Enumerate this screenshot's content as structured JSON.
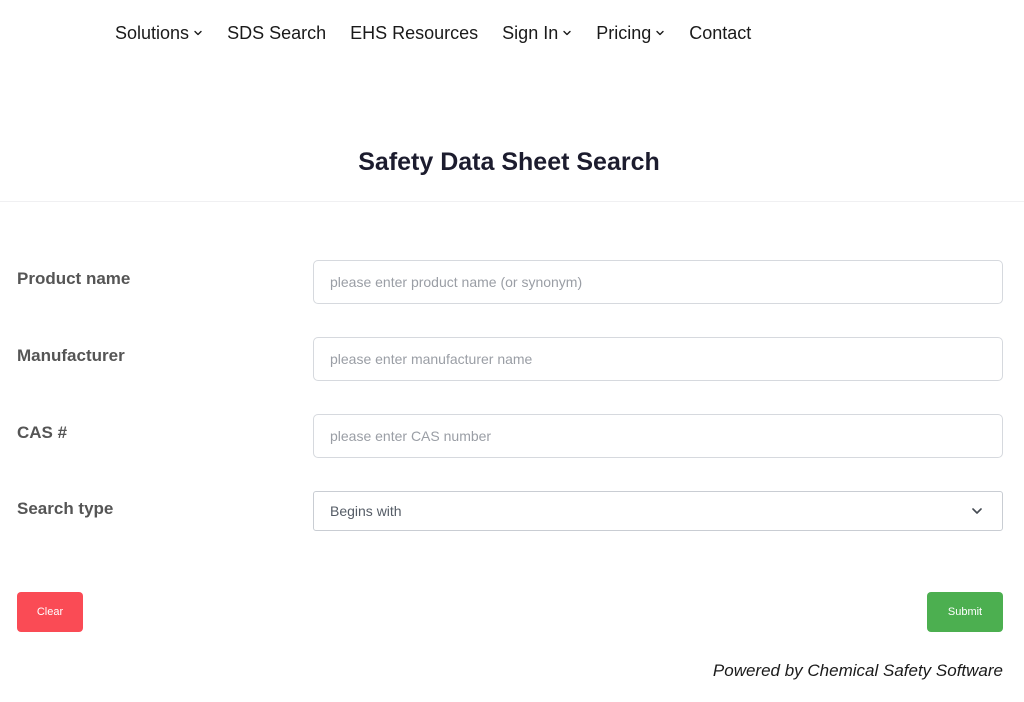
{
  "nav": {
    "items": [
      {
        "label": "Solutions",
        "has_dropdown": true
      },
      {
        "label": "SDS Search",
        "has_dropdown": false
      },
      {
        "label": "EHS Resources",
        "has_dropdown": false
      },
      {
        "label": "Sign In",
        "has_dropdown": true
      },
      {
        "label": "Pricing",
        "has_dropdown": true
      },
      {
        "label": "Contact",
        "has_dropdown": false
      }
    ]
  },
  "page": {
    "title": "Safety Data Sheet Search"
  },
  "form": {
    "product_name": {
      "label": "Product name",
      "value": "",
      "placeholder": "please enter product name (or synonym)"
    },
    "manufacturer": {
      "label": "Manufacturer",
      "value": "",
      "placeholder": "please enter manufacturer name"
    },
    "cas": {
      "label": "CAS #",
      "value": "",
      "placeholder": "please enter CAS number"
    },
    "search_type": {
      "label": "Search type",
      "selected": "Begins with"
    }
  },
  "actions": {
    "clear_label": "Clear",
    "submit_label": "Submit"
  },
  "footer": {
    "powered_by": "Powered by Chemical Safety Software"
  },
  "colors": {
    "clear_button": "#fa4b55",
    "submit_button": "#4caf50",
    "title_text": "#1c1c2e",
    "label_text": "#555555"
  },
  "icons": {
    "nav_dropdown": "chevron-down-icon",
    "select_dropdown": "chevron-down-icon"
  }
}
